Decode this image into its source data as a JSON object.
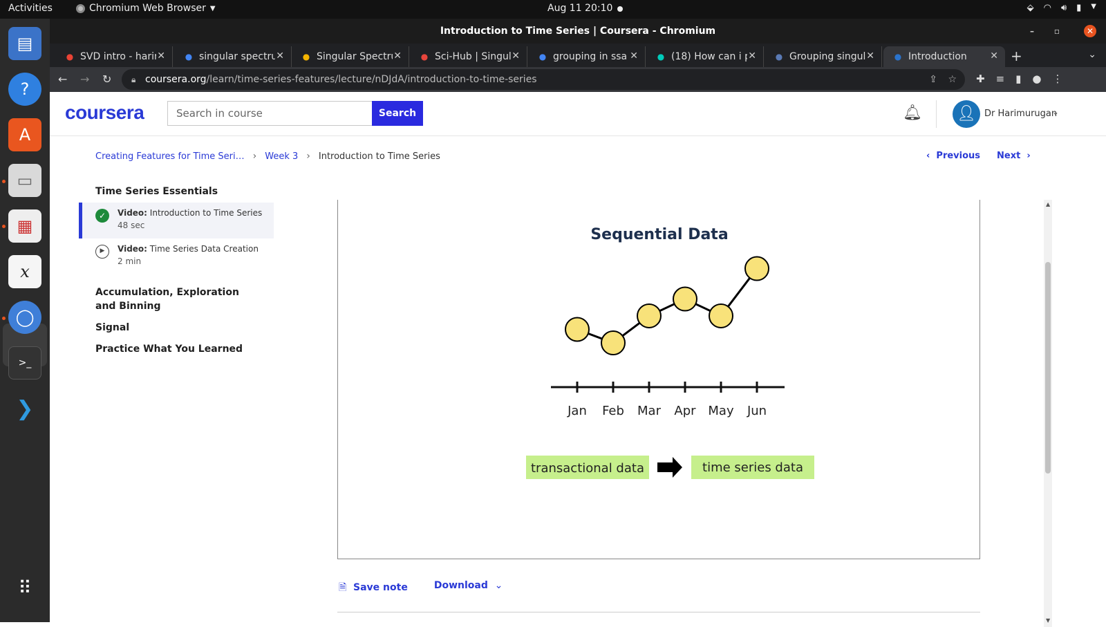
{
  "os": {
    "activities": "Activities",
    "app_name": "Chromium Web Browser",
    "clock": "Aug 11  20:10"
  },
  "window": {
    "title": "Introduction to Time Series | Coursera - Chromium"
  },
  "tabs": [
    {
      "title": "SVD intro - harimurugan",
      "favicon": "gmail-icon",
      "color": "#ea4335"
    },
    {
      "title": "singular spectrum",
      "favicon": "google-icon",
      "color": "#4285f4"
    },
    {
      "title": "Singular Spectrum",
      "favicon": "scholar-icon",
      "color": "#f4b400"
    },
    {
      "title": "Sci-Hub | Singular",
      "favicon": "scihub-icon",
      "color": "#e8453c"
    },
    {
      "title": "grouping in ssa",
      "favicon": "google-icon",
      "color": "#4285f4"
    },
    {
      "title": "(18) How can i p",
      "favicon": "researchgate-icon",
      "color": "#00ccbb"
    },
    {
      "title": "Grouping singular",
      "favicon": "ieee-icon",
      "color": "#5a7ab5"
    },
    {
      "title": "Introduction",
      "favicon": "coursera-icon",
      "color": "#2a73cc"
    }
  ],
  "address": {
    "host": "coursera.org",
    "path": "/learn/time-series-features/lecture/nDJdA/introduction-to-time-series"
  },
  "header": {
    "logo": "coursera",
    "search_placeholder": "Search in course",
    "search_label": "Search",
    "username": "Dr Harimurugan"
  },
  "breadcrumb": {
    "course": "Creating Features for Time Seri…",
    "week": "Week 3",
    "current": "Introduction to Time Series"
  },
  "pager": {
    "previous": "Previous",
    "next": "Next"
  },
  "sidebar": {
    "sections": [
      {
        "title": "Time Series Essentials"
      },
      {
        "title": "Accumulation, Exploration and Binning"
      },
      {
        "title": "Signal"
      },
      {
        "title": "Practice What You Learned"
      }
    ],
    "items": [
      {
        "kind": "Video:",
        "title": "Introduction to Time Series",
        "duration": "48 sec"
      },
      {
        "kind": "Video:",
        "title": "Time Series Data Creation",
        "duration": "2 min"
      }
    ]
  },
  "slide": {
    "title": "Sequential Data",
    "box_left": "transactional data",
    "box_right": "time series data",
    "box_color": "#c6ef8c",
    "point_color": "#f8e27a"
  },
  "chart_data": {
    "type": "line",
    "categories": [
      "Jan",
      "Feb",
      "Mar",
      "Apr",
      "May",
      "Jun"
    ],
    "values": [
      2.6,
      1.8,
      3.4,
      4.4,
      3.4,
      6.2
    ],
    "title": "Sequential Data",
    "xlabel": "",
    "ylabel": "",
    "ylim": [
      0,
      7
    ],
    "grid": false,
    "legend": "none"
  },
  "footer_actions": {
    "save_note": "Save note",
    "download": "Download"
  }
}
